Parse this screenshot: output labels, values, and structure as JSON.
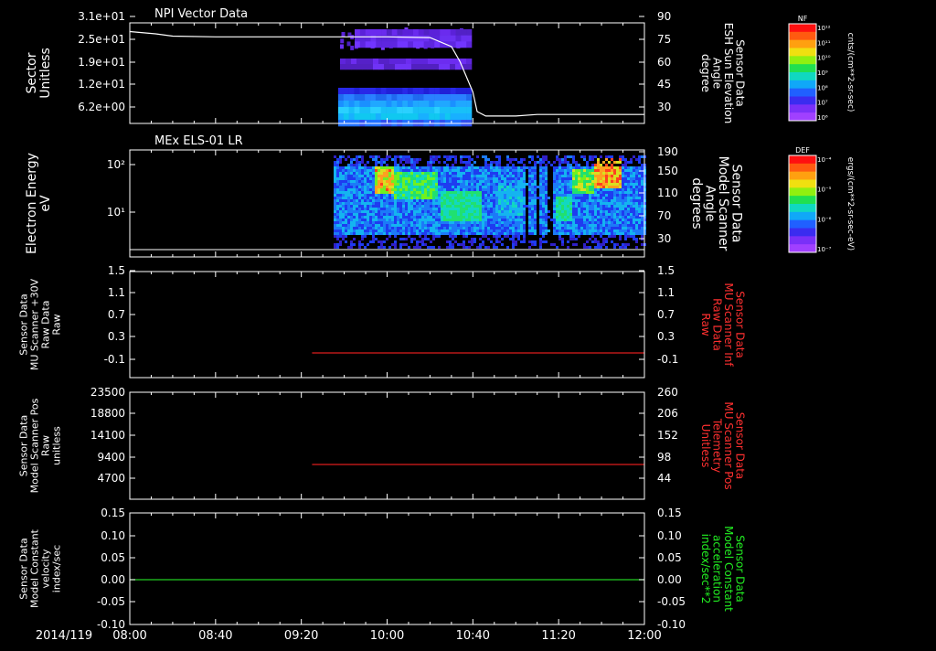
{
  "chart_data": [
    {
      "type": "heatmap",
      "title": "NPI Vector Data",
      "y_left": {
        "label": [
          "Sector",
          "Unitless"
        ],
        "ticks": [
          "3.1e+01",
          "2.5e+01",
          "1.9e+01",
          "1.2e+01",
          "6.2e+00"
        ]
      },
      "y_right": {
        "label": [
          "Sensor Data",
          "ESH Sun Elevation",
          "Angle",
          "degree"
        ],
        "ticks": [
          "90",
          "75",
          "60",
          "45",
          "30"
        ],
        "range": [
          18,
          90
        ]
      },
      "colorbar": {
        "label": "NF",
        "units": "cnts/(cm**2-sr-sec)",
        "ticks": [
          "10¹²",
          "10¹¹",
          "10¹⁰",
          "10⁹",
          "10⁸",
          "10⁷",
          "10⁶"
        ]
      },
      "line_series": {
        "name": "",
        "x": [
          "08:00",
          "08:12",
          "08:20",
          "08:40",
          "09:20",
          "10:00",
          "10:20",
          "10:30",
          "10:34",
          "10:40",
          "10:42",
          "10:46",
          "11:00",
          "11:10",
          "11:30",
          "12:00"
        ],
        "y": [
          80,
          78.5,
          77,
          76.5,
          76.5,
          76.5,
          76,
          70,
          60,
          40,
          27,
          24,
          24,
          25,
          25,
          25
        ]
      }
    },
    {
      "type": "heatmap",
      "title": "MEx ELS-01 LR",
      "y_left": {
        "label": [
          "Electron Energy",
          "eV"
        ],
        "ticks": [
          "10²",
          "10¹"
        ]
      },
      "y_right": {
        "label": [
          "Sensor Data",
          "Model Scanner",
          "Angle",
          "degrees"
        ],
        "ticks": [
          "190",
          "150",
          "110",
          "70",
          "30"
        ]
      },
      "colorbar": {
        "label": "DEF",
        "units": "ergs/(cm**2-sr-sec-eV)",
        "ticks": [
          "10⁻⁴",
          "10⁻⁵",
          "10⁻⁶",
          "10⁻⁷"
        ]
      },
      "line_series": {
        "name": "",
        "constant_value": 0
      }
    },
    {
      "type": "line",
      "y_left": {
        "label": [
          "Sensor Data",
          "MU Scanner +30V",
          "Raw Data",
          "Raw"
        ],
        "ticks": [
          "1.5",
          "1.1",
          "0.7",
          "0.3",
          "-0.1"
        ],
        "range": [
          -0.4,
          1.5
        ]
      },
      "y_right": {
        "label": [
          "Sensor Data",
          "MU Scanner Inf",
          "Raw Data",
          "Raw"
        ],
        "ticks": [
          "1.5",
          "1.1",
          "0.7",
          "0.3",
          "-0.1"
        ],
        "color": "#ff3030"
      },
      "series": [
        {
          "name": "",
          "color": "#dd1c1c",
          "x_start": "09:25",
          "x_end": "12:00",
          "value": 0.0
        }
      ]
    },
    {
      "type": "line",
      "y_left": {
        "label": [
          "Sensor Data",
          "Model Scanner Pos",
          "Raw",
          "unitless"
        ],
        "ticks": [
          "23500",
          "18800",
          "14100",
          "9400",
          "4700"
        ],
        "range": [
          0,
          23500
        ]
      },
      "y_right": {
        "label": [
          "Sensor Data",
          "MU Scanner Pos",
          "Telemetry",
          "Unitless"
        ],
        "ticks": [
          "260",
          "206",
          "152",
          "98",
          "44"
        ],
        "range": [
          0,
          260
        ],
        "color": "#ff3030"
      },
      "series": [
        {
          "name": "",
          "color": "#dd1c1c",
          "x_start": "09:25",
          "x_end": "12:00",
          "value": 85
        }
      ]
    },
    {
      "type": "line",
      "y_left": {
        "label": [
          "Sensor Data",
          "Model Constant",
          "velocity",
          "index/sec"
        ],
        "ticks": [
          "0.15",
          "0.10",
          "0.05",
          "0.00",
          "-0.05",
          "-0.10"
        ],
        "range": [
          -0.1,
          0.15
        ]
      },
      "y_right": {
        "label": [
          "Sensor Data",
          "Model Constant",
          "acceleration",
          "index/sec**2"
        ],
        "ticks": [
          "0.15",
          "0.10",
          "0.05",
          "0.00",
          "-0.05",
          "-0.10"
        ],
        "color": "#22ee22"
      },
      "series": [
        {
          "name": "",
          "color": "#22cc22",
          "x_start": "08:00",
          "x_end": "12:00",
          "value": 0.0
        }
      ]
    }
  ],
  "x_axis": {
    "date_label": "2014/119",
    "ticks": [
      "08:00",
      "08:40",
      "09:20",
      "10:00",
      "10:40",
      "11:20",
      "12:00"
    ],
    "range": [
      "08:00",
      "12:00"
    ]
  }
}
